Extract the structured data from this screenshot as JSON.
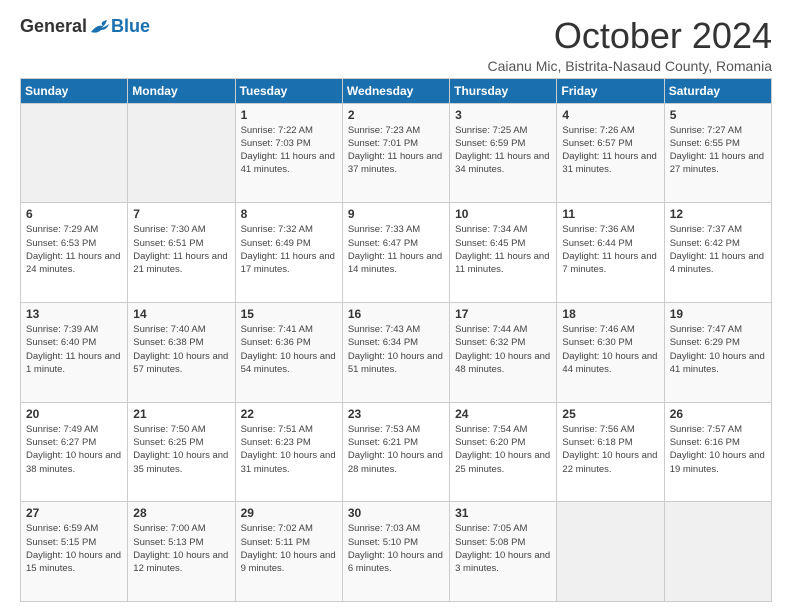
{
  "logo": {
    "general": "General",
    "blue": "Blue"
  },
  "header": {
    "month": "October 2024",
    "location": "Caianu Mic, Bistrita-Nasaud County, Romania"
  },
  "weekdays": [
    "Sunday",
    "Monday",
    "Tuesday",
    "Wednesday",
    "Thursday",
    "Friday",
    "Saturday"
  ],
  "weeks": [
    [
      {
        "day": "",
        "sunrise": "",
        "sunset": "",
        "daylight": ""
      },
      {
        "day": "",
        "sunrise": "",
        "sunset": "",
        "daylight": ""
      },
      {
        "day": "1",
        "sunrise": "Sunrise: 7:22 AM",
        "sunset": "Sunset: 7:03 PM",
        "daylight": "Daylight: 11 hours and 41 minutes."
      },
      {
        "day": "2",
        "sunrise": "Sunrise: 7:23 AM",
        "sunset": "Sunset: 7:01 PM",
        "daylight": "Daylight: 11 hours and 37 minutes."
      },
      {
        "day": "3",
        "sunrise": "Sunrise: 7:25 AM",
        "sunset": "Sunset: 6:59 PM",
        "daylight": "Daylight: 11 hours and 34 minutes."
      },
      {
        "day": "4",
        "sunrise": "Sunrise: 7:26 AM",
        "sunset": "Sunset: 6:57 PM",
        "daylight": "Daylight: 11 hours and 31 minutes."
      },
      {
        "day": "5",
        "sunrise": "Sunrise: 7:27 AM",
        "sunset": "Sunset: 6:55 PM",
        "daylight": "Daylight: 11 hours and 27 minutes."
      }
    ],
    [
      {
        "day": "6",
        "sunrise": "Sunrise: 7:29 AM",
        "sunset": "Sunset: 6:53 PM",
        "daylight": "Daylight: 11 hours and 24 minutes."
      },
      {
        "day": "7",
        "sunrise": "Sunrise: 7:30 AM",
        "sunset": "Sunset: 6:51 PM",
        "daylight": "Daylight: 11 hours and 21 minutes."
      },
      {
        "day": "8",
        "sunrise": "Sunrise: 7:32 AM",
        "sunset": "Sunset: 6:49 PM",
        "daylight": "Daylight: 11 hours and 17 minutes."
      },
      {
        "day": "9",
        "sunrise": "Sunrise: 7:33 AM",
        "sunset": "Sunset: 6:47 PM",
        "daylight": "Daylight: 11 hours and 14 minutes."
      },
      {
        "day": "10",
        "sunrise": "Sunrise: 7:34 AM",
        "sunset": "Sunset: 6:45 PM",
        "daylight": "Daylight: 11 hours and 11 minutes."
      },
      {
        "day": "11",
        "sunrise": "Sunrise: 7:36 AM",
        "sunset": "Sunset: 6:44 PM",
        "daylight": "Daylight: 11 hours and 7 minutes."
      },
      {
        "day": "12",
        "sunrise": "Sunrise: 7:37 AM",
        "sunset": "Sunset: 6:42 PM",
        "daylight": "Daylight: 11 hours and 4 minutes."
      }
    ],
    [
      {
        "day": "13",
        "sunrise": "Sunrise: 7:39 AM",
        "sunset": "Sunset: 6:40 PM",
        "daylight": "Daylight: 11 hours and 1 minute."
      },
      {
        "day": "14",
        "sunrise": "Sunrise: 7:40 AM",
        "sunset": "Sunset: 6:38 PM",
        "daylight": "Daylight: 10 hours and 57 minutes."
      },
      {
        "day": "15",
        "sunrise": "Sunrise: 7:41 AM",
        "sunset": "Sunset: 6:36 PM",
        "daylight": "Daylight: 10 hours and 54 minutes."
      },
      {
        "day": "16",
        "sunrise": "Sunrise: 7:43 AM",
        "sunset": "Sunset: 6:34 PM",
        "daylight": "Daylight: 10 hours and 51 minutes."
      },
      {
        "day": "17",
        "sunrise": "Sunrise: 7:44 AM",
        "sunset": "Sunset: 6:32 PM",
        "daylight": "Daylight: 10 hours and 48 minutes."
      },
      {
        "day": "18",
        "sunrise": "Sunrise: 7:46 AM",
        "sunset": "Sunset: 6:30 PM",
        "daylight": "Daylight: 10 hours and 44 minutes."
      },
      {
        "day": "19",
        "sunrise": "Sunrise: 7:47 AM",
        "sunset": "Sunset: 6:29 PM",
        "daylight": "Daylight: 10 hours and 41 minutes."
      }
    ],
    [
      {
        "day": "20",
        "sunrise": "Sunrise: 7:49 AM",
        "sunset": "Sunset: 6:27 PM",
        "daylight": "Daylight: 10 hours and 38 minutes."
      },
      {
        "day": "21",
        "sunrise": "Sunrise: 7:50 AM",
        "sunset": "Sunset: 6:25 PM",
        "daylight": "Daylight: 10 hours and 35 minutes."
      },
      {
        "day": "22",
        "sunrise": "Sunrise: 7:51 AM",
        "sunset": "Sunset: 6:23 PM",
        "daylight": "Daylight: 10 hours and 31 minutes."
      },
      {
        "day": "23",
        "sunrise": "Sunrise: 7:53 AM",
        "sunset": "Sunset: 6:21 PM",
        "daylight": "Daylight: 10 hours and 28 minutes."
      },
      {
        "day": "24",
        "sunrise": "Sunrise: 7:54 AM",
        "sunset": "Sunset: 6:20 PM",
        "daylight": "Daylight: 10 hours and 25 minutes."
      },
      {
        "day": "25",
        "sunrise": "Sunrise: 7:56 AM",
        "sunset": "Sunset: 6:18 PM",
        "daylight": "Daylight: 10 hours and 22 minutes."
      },
      {
        "day": "26",
        "sunrise": "Sunrise: 7:57 AM",
        "sunset": "Sunset: 6:16 PM",
        "daylight": "Daylight: 10 hours and 19 minutes."
      }
    ],
    [
      {
        "day": "27",
        "sunrise": "Sunrise: 6:59 AM",
        "sunset": "Sunset: 5:15 PM",
        "daylight": "Daylight: 10 hours and 15 minutes."
      },
      {
        "day": "28",
        "sunrise": "Sunrise: 7:00 AM",
        "sunset": "Sunset: 5:13 PM",
        "daylight": "Daylight: 10 hours and 12 minutes."
      },
      {
        "day": "29",
        "sunrise": "Sunrise: 7:02 AM",
        "sunset": "Sunset: 5:11 PM",
        "daylight": "Daylight: 10 hours and 9 minutes."
      },
      {
        "day": "30",
        "sunrise": "Sunrise: 7:03 AM",
        "sunset": "Sunset: 5:10 PM",
        "daylight": "Daylight: 10 hours and 6 minutes."
      },
      {
        "day": "31",
        "sunrise": "Sunrise: 7:05 AM",
        "sunset": "Sunset: 5:08 PM",
        "daylight": "Daylight: 10 hours and 3 minutes."
      },
      {
        "day": "",
        "sunrise": "",
        "sunset": "",
        "daylight": ""
      },
      {
        "day": "",
        "sunrise": "",
        "sunset": "",
        "daylight": ""
      }
    ]
  ]
}
